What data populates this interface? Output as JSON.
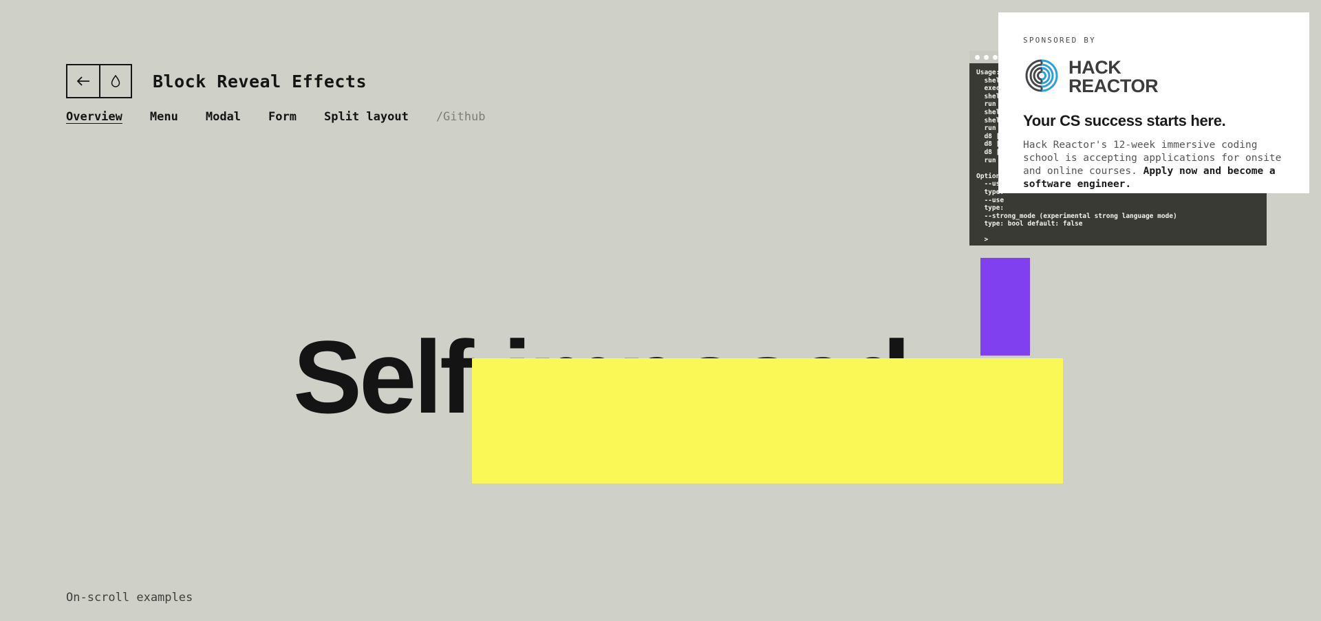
{
  "colors": {
    "background": "#cfd0c8",
    "ink": "#141414",
    "accent_purple": "#8040f0",
    "accent_yellow": "#faf857",
    "terminal_bg": "#3a3a35",
    "terminal_titlebar": "#c9cac2",
    "card_bg": "#ffffff",
    "logo_blue": "#2f9fd8",
    "logo_gray": "#44464a",
    "muted_text": "#7d7e78"
  },
  "header": {
    "title": "Block Reveal Effects",
    "back_icon": "arrow-left-icon",
    "theme_icon": "droplet-icon"
  },
  "nav": {
    "items": [
      {
        "label": "Overview",
        "active": true,
        "muted": false
      },
      {
        "label": "Menu",
        "active": false,
        "muted": false
      },
      {
        "label": "Modal",
        "active": false,
        "muted": false
      },
      {
        "label": "Form",
        "active": false,
        "muted": false
      },
      {
        "label": "Split layout",
        "active": false,
        "muted": false
      },
      {
        "label": "/Github",
        "active": false,
        "muted": true
      }
    ]
  },
  "hero": {
    "headline": "Self-imposed",
    "blocks": [
      {
        "name": "purple",
        "color": "#8040f0"
      },
      {
        "name": "yellow",
        "color": "#faf857"
      }
    ]
  },
  "terminal": {
    "dots": 3,
    "lines": [
      "Usage:",
      "  shell",
      "  execu",
      "  shell",
      "  run  ",
      "  shell",
      "  shell",
      "  run  ",
      "  d8 [o",
      "  d8 [o",
      "  d8 [o",
      "  run t",
      "",
      "Option",
      "  --use",
      "  type:",
      "  --use",
      "  type:",
      "  --strong_mode (experimental strong language mode)",
      "  type: bool default: false",
      "",
      "  >"
    ]
  },
  "sponsor": {
    "label": "SPONSORED BY",
    "logo_name": "hack-reactor-logo",
    "brand_line1": "HACK",
    "brand_line2": "REACTOR",
    "headline": "Your CS success starts here.",
    "body_text": "Hack Reactor's 12-week immersive coding school is accepting applications for onsite and online courses. ",
    "cta_text": "Apply now and become a software engineer."
  },
  "footer": {
    "note": "On-scroll examples"
  }
}
